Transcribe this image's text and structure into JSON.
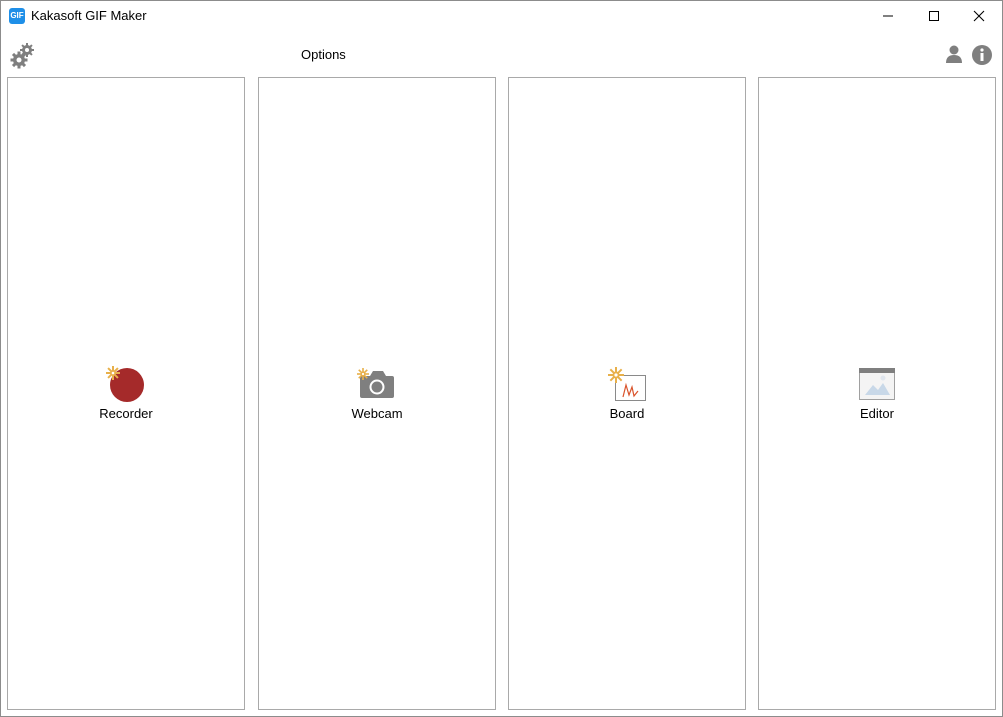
{
  "window": {
    "title": "Kakasoft GIF Maker",
    "app_icon_text": "GIF",
    "controls": [
      "minimize-icon",
      "maximize-icon",
      "close-icon"
    ]
  },
  "toolbar": {
    "options_label": "Options",
    "left_icon": "gears-icon",
    "right_icons": [
      "user-icon",
      "info-icon"
    ]
  },
  "panels": [
    {
      "label": "Recorder",
      "icon": "record-icon"
    },
    {
      "label": "Webcam",
      "icon": "camera-icon"
    },
    {
      "label": "Board",
      "icon": "board-icon"
    },
    {
      "label": "Editor",
      "icon": "editor-image-icon"
    }
  ],
  "colors": {
    "accent_blue": "#1e8fe8",
    "record_red": "#a52a2a",
    "icon_gray": "#7f7f7f",
    "sparkle_gold": "#e8b04a",
    "panel_border": "#a9a9a9"
  }
}
